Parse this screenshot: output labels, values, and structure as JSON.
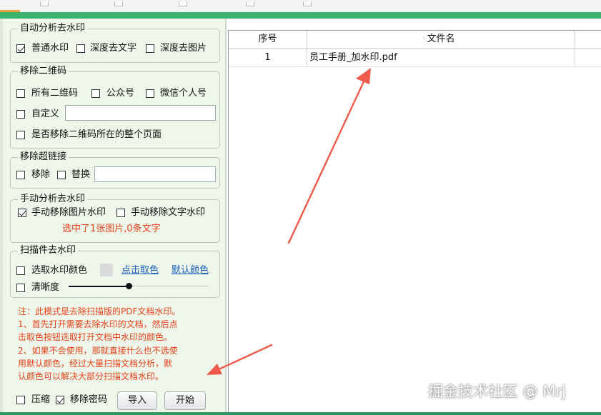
{
  "auto_watermark": {
    "legend": "自动分析去水印",
    "normal": {
      "label": "普通水印",
      "checked": true
    },
    "deep_text": {
      "label": "深度去文字",
      "checked": false
    },
    "deep_image": {
      "label": "深度去图片",
      "checked": false
    }
  },
  "qr": {
    "legend": "移除二维码",
    "all": {
      "label": "所有二维码",
      "checked": false
    },
    "official": {
      "label": "公众号",
      "checked": false
    },
    "wechat": {
      "label": "微信个人号",
      "checked": false
    },
    "custom": {
      "label": "自定义",
      "checked": false,
      "value": ""
    },
    "whole_page": {
      "label": "是否移除二维码所在的整个页面",
      "checked": false
    }
  },
  "hyperlink": {
    "legend": "移除超链接",
    "remove": {
      "label": "移除",
      "checked": false
    },
    "replace": {
      "label": "替换",
      "checked": false,
      "value": ""
    }
  },
  "manual": {
    "legend": "手动分析去水印",
    "image": {
      "label": "手动移除图片水印",
      "checked": true
    },
    "text": {
      "label": "手动移除文字水印",
      "checked": false
    },
    "status": "选中了1张图片,0条文字"
  },
  "scan": {
    "legend": "扫描件去水印",
    "color": {
      "label": "选取水印颜色",
      "checked": false
    },
    "swatch_color": "#dadada",
    "pick_link": "点击取色",
    "default_link": "默认颜色",
    "clarity": {
      "label": "清晰度",
      "checked": false,
      "value": 0.43
    }
  },
  "notes": [
    "注：此模式是去除扫描版的PDF文档水印。",
    "1、首先打开需要去除水印的文档，然后点",
    "击取色按钮选取打开文档中水印的颜色。",
    "2、如果不会使用，那就直接什么也不选使",
    "用默认颜色，经过大量扫描文档分析，默",
    "认颜色可以解决大部分扫描文档水印。"
  ],
  "bottom": {
    "compress": {
      "label": "压缩",
      "checked": false
    },
    "remove_password": {
      "label": "移除密码",
      "checked": true
    },
    "import_label": "导入",
    "start_label": "开始"
  },
  "table": {
    "columns": [
      "序号",
      "文件名"
    ],
    "rows": [
      {
        "index": "1",
        "filename": "员工手册_加水印.pdf"
      }
    ]
  },
  "watermark_text": "掘金技术社区 @ Mrj",
  "colors": {
    "accent_green": "#3cb371",
    "panel_bg": "#eef7ea",
    "annotation_red": "#e8401a",
    "link_blue": "#1a5fc0"
  }
}
